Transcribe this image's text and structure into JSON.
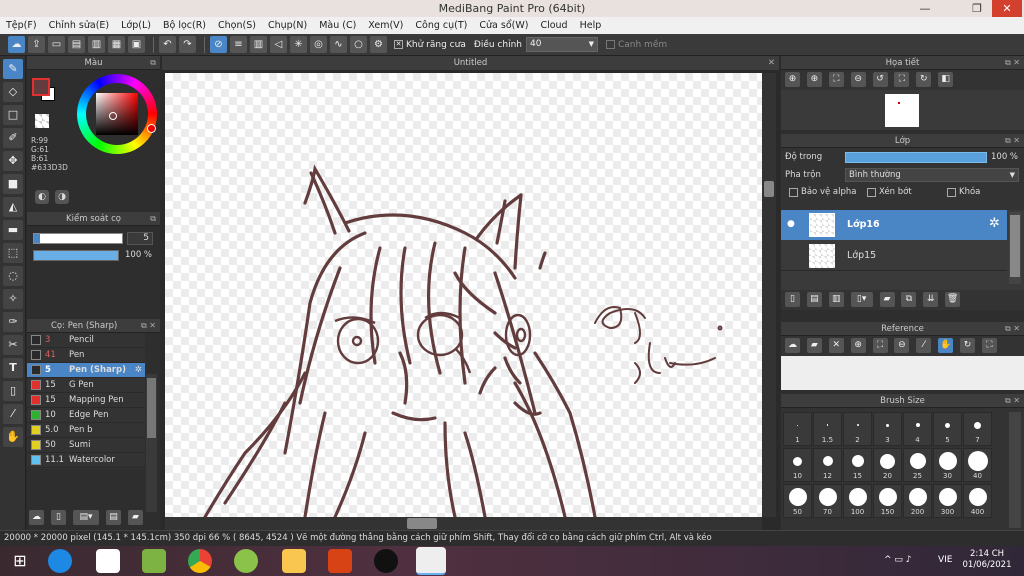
{
  "window": {
    "title": "MediBang Paint Pro (64bit)",
    "min": "—",
    "max": "❐",
    "close": "✕"
  },
  "menu": [
    "Tệp(F)",
    "Chỉnh sửa(E)",
    "Lớp(L)",
    "Bộ lọc(R)",
    "Chọn(S)",
    "Chụp(N)",
    "Màu (C)",
    "Xem(V)",
    "Công cụ(T)",
    "Cửa sổ(W)",
    "Cloud",
    "Help"
  ],
  "toolbar": {
    "antialias_label": "Khử răng cưa",
    "adjust_label": "Điều chỉnh",
    "adjust_value": "40",
    "edge_label": "Canh mềm"
  },
  "color_panel": {
    "title": "Màu",
    "r": "R:99",
    "g": "G:61",
    "b": "B:61",
    "hex": "#633D3D",
    "color": "#633D3D"
  },
  "brush_control": {
    "title": "Kiểm soát cọ",
    "size": "5",
    "opacity": "100 %",
    "opacity_fraction": 1.0
  },
  "brush_list": {
    "title": "Cọ: Pen (Sharp)",
    "items": [
      {
        "size": "3",
        "name": "Pencil",
        "color": "#2a2a2a",
        "selected": false
      },
      {
        "size": "41",
        "name": "Pen",
        "color": "#2a2a2a",
        "selected": false
      },
      {
        "size": "5",
        "name": "Pen (Sharp)",
        "color": "#2a2a2a",
        "selected": true
      },
      {
        "size": "15",
        "name": "G Pen",
        "color": "#e03030",
        "selected": false
      },
      {
        "size": "15",
        "name": "Mapping Pen",
        "color": "#e03030",
        "selected": false
      },
      {
        "size": "10",
        "name": "Edge Pen",
        "color": "#30b030",
        "selected": false
      },
      {
        "size": "5.0",
        "name": "Pen b",
        "color": "#e0d020",
        "selected": false
      },
      {
        "size": "50",
        "name": "Sumi",
        "color": "#e0d020",
        "selected": false
      },
      {
        "size": "11.1",
        "name": "Watercolor",
        "color": "#60c0f0",
        "selected": false
      }
    ]
  },
  "canvas": {
    "tab_title": "Untitled"
  },
  "navigator": {
    "title": "Họa tiết"
  },
  "layer_panel": {
    "title": "Lớp",
    "opacity_label": "Độ trong",
    "opacity_value": "100 %",
    "blend_label": "Pha trộn",
    "blend_value": "Bình thường",
    "alpha_label": "Bảo vệ alpha",
    "clip_label": "Xén bớt",
    "lock_label": "Khóa",
    "layers": [
      {
        "name": "Lớp16",
        "selected": true
      },
      {
        "name": "Lớp15",
        "selected": false
      }
    ]
  },
  "reference": {
    "title": "Reference"
  },
  "brush_size": {
    "title": "Brush Size",
    "sizes": [
      "1",
      "1.5",
      "2",
      "3",
      "4",
      "5",
      "7",
      "10",
      "12",
      "15",
      "20",
      "25",
      "30",
      "40",
      "50",
      "70",
      "100",
      "150",
      "200",
      "300",
      "400"
    ]
  },
  "status": {
    "text": "20000 * 20000 pixel   (145.1 * 145.1cm)   350 dpi   66 %   ( 8645, 4524 )   Vẽ một đường thẳng bằng cách giữ phím Shift, Thay đổi cỡ cọ bằng cách giữ phím Ctrl, Alt và kéo"
  },
  "taskbar": {
    "lang": "VIE",
    "time": "2:14 CH",
    "date": "01/06/2021"
  }
}
